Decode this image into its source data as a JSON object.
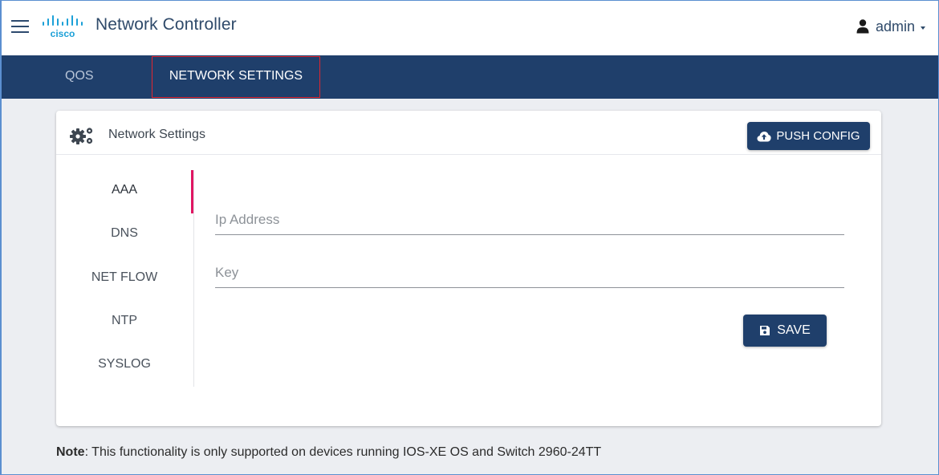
{
  "header": {
    "logo_text": "cisco",
    "app_title": "Network Controller",
    "user_name": "admin"
  },
  "nav": {
    "tabs": [
      {
        "label": "QOS"
      },
      {
        "label": "NETWORK SETTINGS",
        "active": true
      }
    ]
  },
  "card": {
    "title": "Network Settings",
    "push_config_label": "PUSH CONFIG",
    "side_menu": [
      {
        "label": "AAA",
        "active": true
      },
      {
        "label": "DNS"
      },
      {
        "label": "NET FLOW"
      },
      {
        "label": "NTP"
      },
      {
        "label": "SYSLOG"
      }
    ],
    "fields": {
      "ip_address": {
        "placeholder": "Ip Address",
        "value": ""
      },
      "key": {
        "placeholder": "Key",
        "value": ""
      }
    },
    "save_label": "SAVE"
  },
  "note": {
    "label": "Note",
    "text": ": This functionality is only supported on devices running IOS-XE OS and Switch 2960-24TT"
  },
  "colors": {
    "nav_background": "#1f3f6b",
    "accent_active": "#e01562",
    "highlight_border": "#e0262f",
    "page_background": "#eceef2"
  }
}
